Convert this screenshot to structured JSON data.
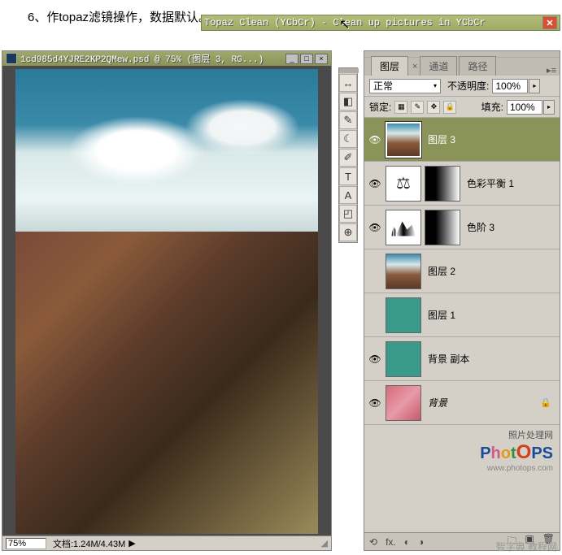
{
  "instruction": "6、作topaz滤镜操作，数据默认。",
  "topaz": {
    "title": "Topaz Clean (YCbCr) - Clean up pictures in YCbCr",
    "close": "✕"
  },
  "ps": {
    "title": "1cd985d4YJRE2KP2QMew.psd @ 75% (图层 3, RG...)",
    "min": "_",
    "max": "□",
    "close": "×",
    "zoom": "75%",
    "docinfo": "文档:1.24M/4.43M",
    "arrow": "▶"
  },
  "tools": [
    "↔",
    "◧",
    "✎",
    "☾",
    "✐",
    "T",
    "A",
    "◰",
    "⊕"
  ],
  "panel": {
    "tabs": {
      "layers": "图层",
      "channels": "通道",
      "paths": "路径"
    },
    "tabx": "×",
    "blend": "正常",
    "opacity_label": "不透明度:",
    "opacity": "100%",
    "lock_label": "锁定:",
    "fill_label": "填充:",
    "fill": "100%",
    "lock_icons": [
      "▦",
      "✎",
      "✥",
      "🔒"
    ],
    "layers": [
      {
        "eye": "👁",
        "name": "图层 3",
        "selected": true,
        "thumb": "sky"
      },
      {
        "eye": "👁",
        "name": "色彩平衡 1",
        "adj": "balance",
        "mask": true
      },
      {
        "eye": "👁",
        "name": "色阶 3",
        "adj": "levels",
        "mask": true
      },
      {
        "eye": "",
        "name": "图层 2",
        "thumb": "sky"
      },
      {
        "eye": "",
        "name": "图层 1",
        "thumb": "teal"
      },
      {
        "eye": "👁",
        "name": "背景 副本",
        "thumb": "teal"
      },
      {
        "eye": "👁",
        "name": "背景",
        "thumb": "pink",
        "locked": "🔒",
        "italic": true
      }
    ],
    "brand_sub": "照片处理网",
    "brand_url": "www.photops.com",
    "footer_icons": {
      "link": "⟲",
      "fx": "fx.",
      "mask": "◐",
      "adj": "◑",
      "folder": "🗀",
      "new": "▣",
      "trash": "🗑"
    }
  },
  "watermark": "智字典 教程网"
}
